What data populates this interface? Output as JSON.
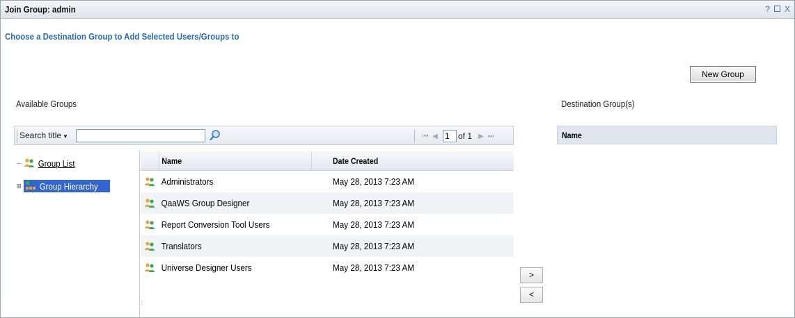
{
  "window": {
    "title": "Join Group: admin",
    "controls": {
      "help": "?",
      "close": "X"
    }
  },
  "subtitle": "Choose a Destination Group to Add Selected Users/Groups to",
  "new_group_button": "New Group",
  "available_label": "Available Groups",
  "destination_label": "Destination Group(s)",
  "toolbar": {
    "search_filter_label": "Search title",
    "search_value": "",
    "pager": {
      "current_page": "1",
      "of_label": "of 1"
    }
  },
  "tree": {
    "items": [
      {
        "label": "Group List",
        "icon": "group-icon"
      },
      {
        "label": "Group Hierarchy",
        "icon": "hierarchy-icon",
        "selected": true
      }
    ]
  },
  "grid": {
    "columns": [
      "Name",
      "Date Created"
    ],
    "rows": [
      {
        "name": "Administrators",
        "date": "May 28, 2013 7:23 AM"
      },
      {
        "name": "QaaWS Group Designer",
        "date": "May 28, 2013 7:23 AM"
      },
      {
        "name": "Report Conversion Tool Users",
        "date": "May 28, 2013 7:23 AM"
      },
      {
        "name": "Translators",
        "date": "May 28, 2013 7:23 AM"
      },
      {
        "name": "Universe Designer Users",
        "date": "May 28, 2013 7:23 AM"
      }
    ]
  },
  "transfer": {
    "add": ">",
    "remove": "<"
  },
  "destination_grid": {
    "columns": [
      "Name"
    ]
  },
  "colors": {
    "accent": "#2a6db5",
    "selection": "#3366cc",
    "icon_person_a": "#e8a33c",
    "icon_person_b": "#3aa655"
  }
}
